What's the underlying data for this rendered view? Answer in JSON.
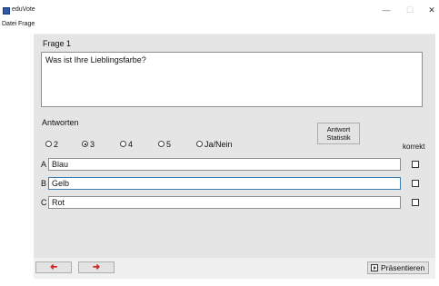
{
  "window": {
    "title": "eduVote",
    "minimize_glyph": "—",
    "maximize_glyph": "☐",
    "close_glyph": "✕"
  },
  "menu": [
    "Datei",
    "Frage"
  ],
  "question": {
    "label": "Frage 1",
    "text": "Was ist Ihre Lieblingsfarbe?"
  },
  "answers": {
    "label": "Antworten",
    "statistic_button": "Antwort Statistik",
    "correct_label": "korrekt",
    "options": [
      {
        "label": "2",
        "checked": false
      },
      {
        "label": "3",
        "checked": true
      },
      {
        "label": "4",
        "checked": false
      },
      {
        "label": "5",
        "checked": false
      },
      {
        "label": "Ja/Nein",
        "checked": false
      }
    ],
    "rows": [
      {
        "letter": "A",
        "value": "Blau",
        "correct": false
      },
      {
        "letter": "B",
        "value": "Gelb",
        "correct": false
      },
      {
        "letter": "C",
        "value": "Rot",
        "correct": false
      }
    ]
  },
  "footer": {
    "prev_glyph": "➜",
    "next_glyph": "➜",
    "present_button": "Präsentieren"
  },
  "colors": {
    "arrow": "#c62828",
    "focus_border": "#3c7fb1"
  }
}
